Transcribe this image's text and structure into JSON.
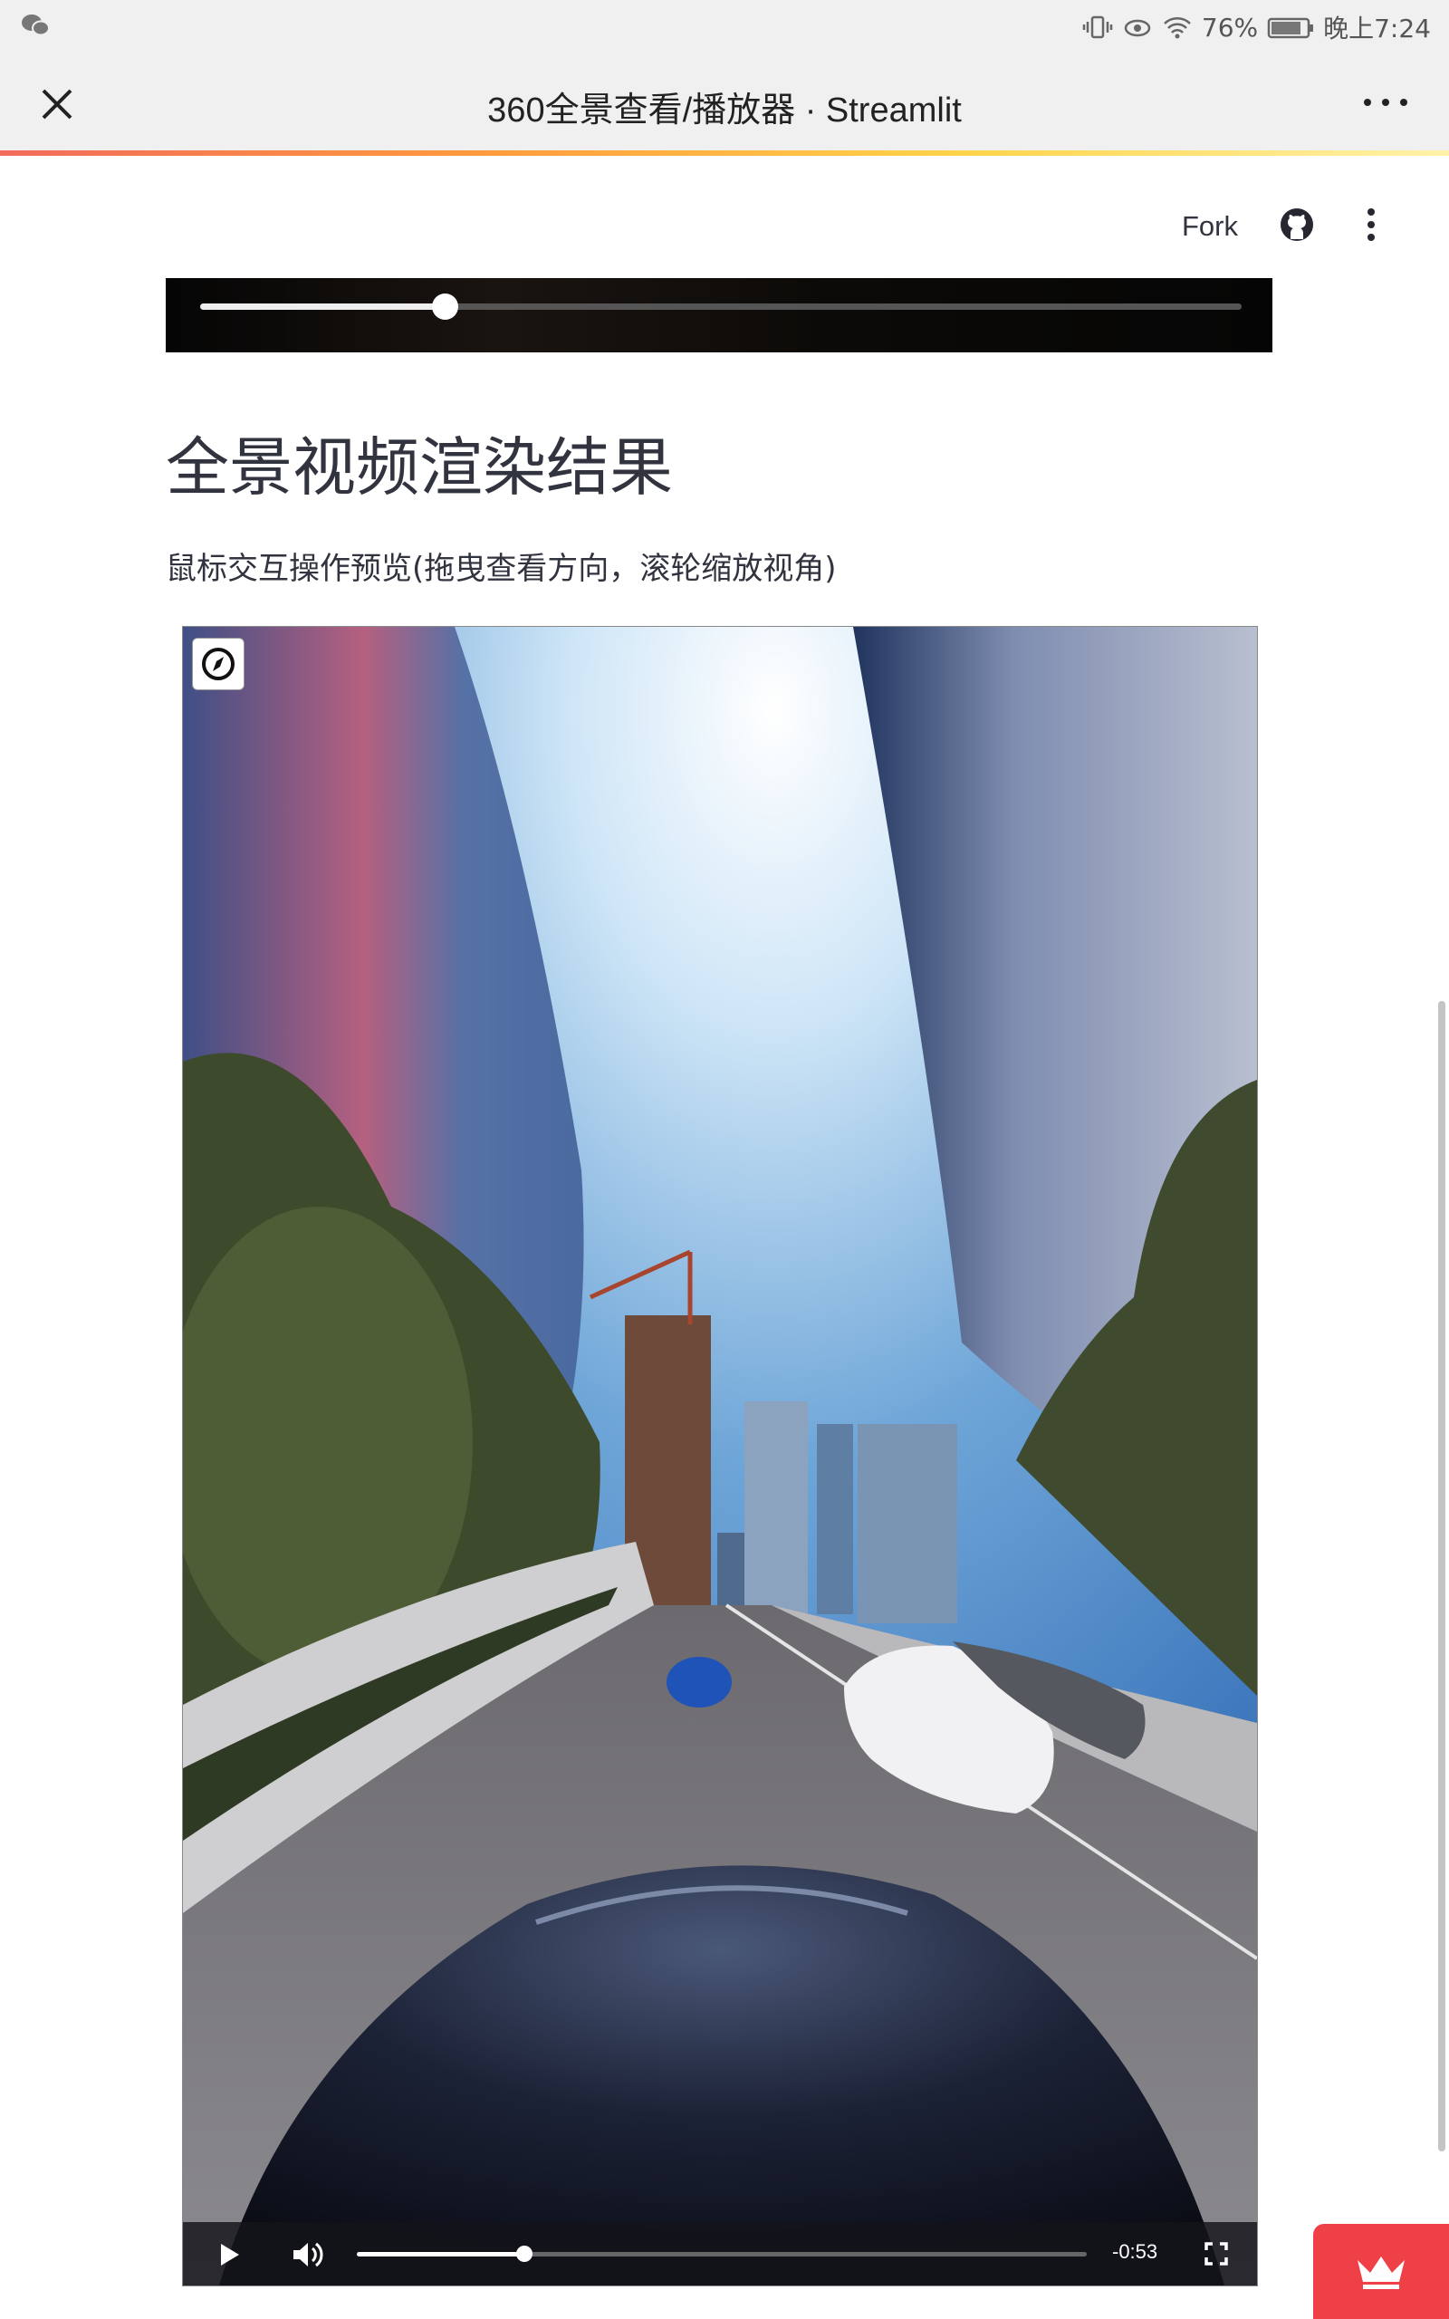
{
  "status_bar": {
    "battery": "76%",
    "time": "晚上7:24"
  },
  "title_bar": {
    "title": "360全景查看/播放器 · Streamlit"
  },
  "header": {
    "fork_label": "Fork"
  },
  "top_video": {
    "progress": 0.235
  },
  "main": {
    "heading": "全景视频渲染结果",
    "description": "鼠标交互操作预览(拖曳查看方向，滚轮缩放视角)"
  },
  "viewer": {
    "progress": 0.23,
    "time_remaining": "-0:53"
  },
  "colors": {
    "accent": "#ef4048",
    "text": "#31333f"
  }
}
